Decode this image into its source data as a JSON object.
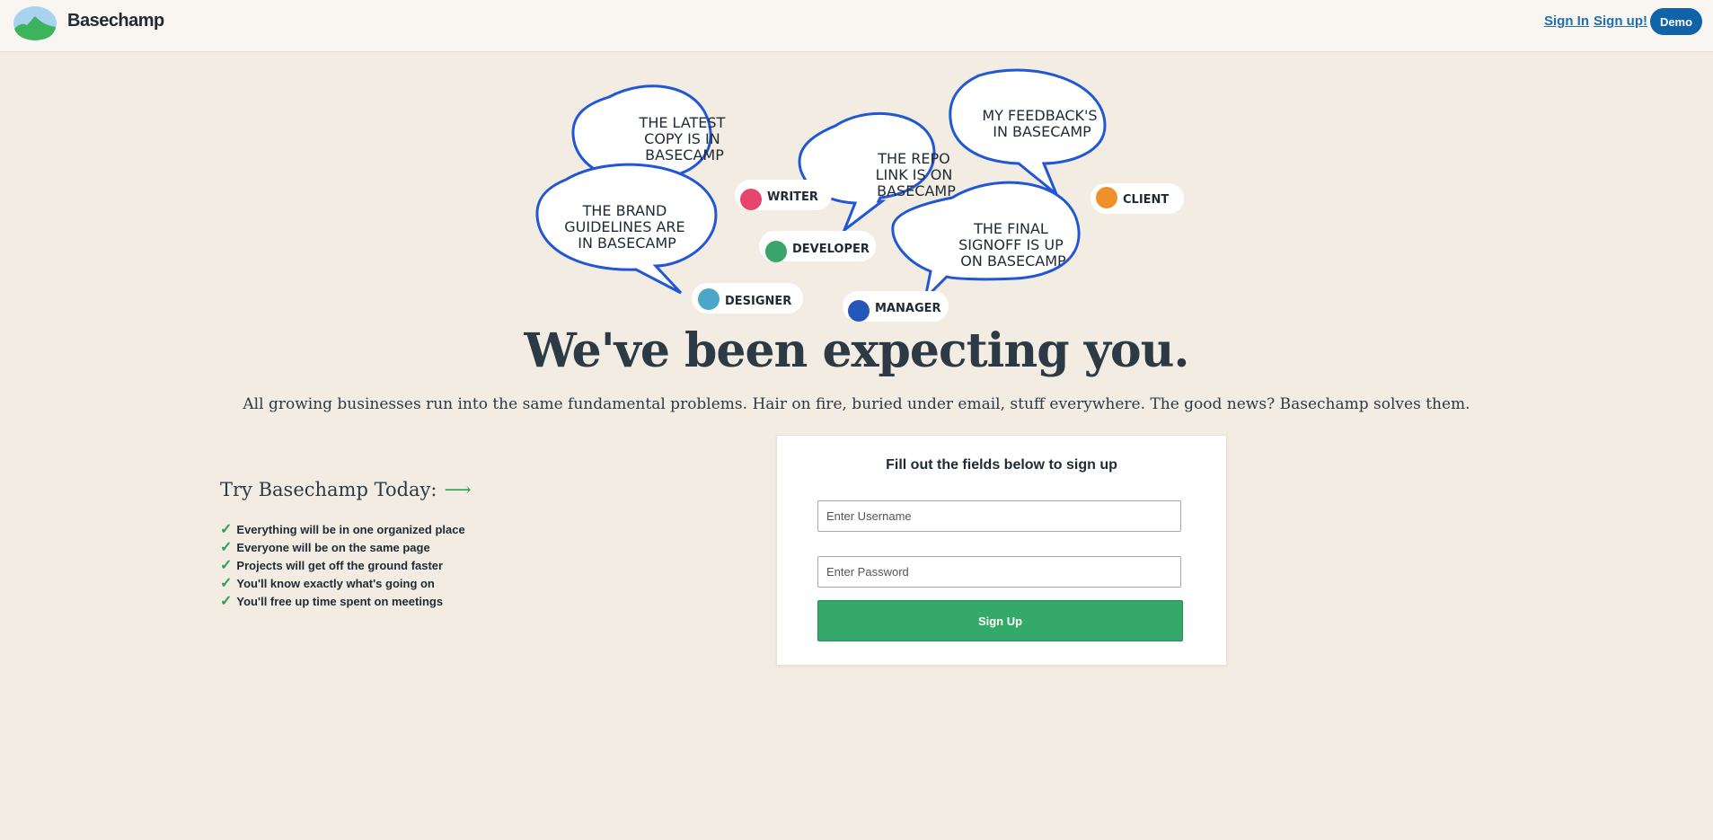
{
  "header": {
    "brand": "Basechamp",
    "sign_in": "Sign In",
    "sign_up": "Sign up!",
    "demo": "Demo"
  },
  "illustration": {
    "bubbles": [
      {
        "id": "latest-copy",
        "lines": [
          "The LATEST",
          "COPY is in",
          "Basecamp"
        ]
      },
      {
        "id": "brand-guidelines",
        "lines": [
          "The BRAND",
          "GUIDELINES are",
          "in Basecamp"
        ]
      },
      {
        "id": "repo-link",
        "lines": [
          "The REPO",
          "LINK is on",
          "Basecamp"
        ]
      },
      {
        "id": "feedback",
        "lines": [
          "My FEEDBACK'S",
          "in Basecamp"
        ]
      },
      {
        "id": "final-signoff",
        "lines": [
          "The FINAL",
          "SIGNOFF is up",
          "on Basecamp"
        ]
      }
    ],
    "tags": [
      {
        "label": "Writer",
        "color": "#e6466d"
      },
      {
        "label": "Developer",
        "color": "#3aa56a"
      },
      {
        "label": "Designer",
        "color": "#4aa7c8"
      },
      {
        "label": "Manager",
        "color": "#2556b8"
      },
      {
        "label": "Client",
        "color": "#f0902a"
      }
    ]
  },
  "hero": {
    "headline": "We've been expecting you.",
    "subhead": "All growing businesses run into the same fundamental problems. Hair on fire, buried under email, stuff everywhere. The good news? Basechamp solves them."
  },
  "promo": {
    "title": "Try Basechamp Today:",
    "arrow": "⟶",
    "check": "✓",
    "benefits": [
      "Everything will be in one organized place",
      "Everyone will be on the same page",
      "Projects will get off the ground faster",
      "You'll know exactly what's going on",
      "You'll free up time spent on meetings"
    ]
  },
  "form": {
    "title": "Fill out the fields below to sign up",
    "username_placeholder": "Enter Username",
    "password_placeholder": "Enter Password",
    "submit": "Sign Up"
  },
  "colors": {
    "background": "#f3ece2",
    "brand_blue": "#1063a8",
    "green": "#34a969",
    "bubble_stroke": "#2157d6"
  }
}
